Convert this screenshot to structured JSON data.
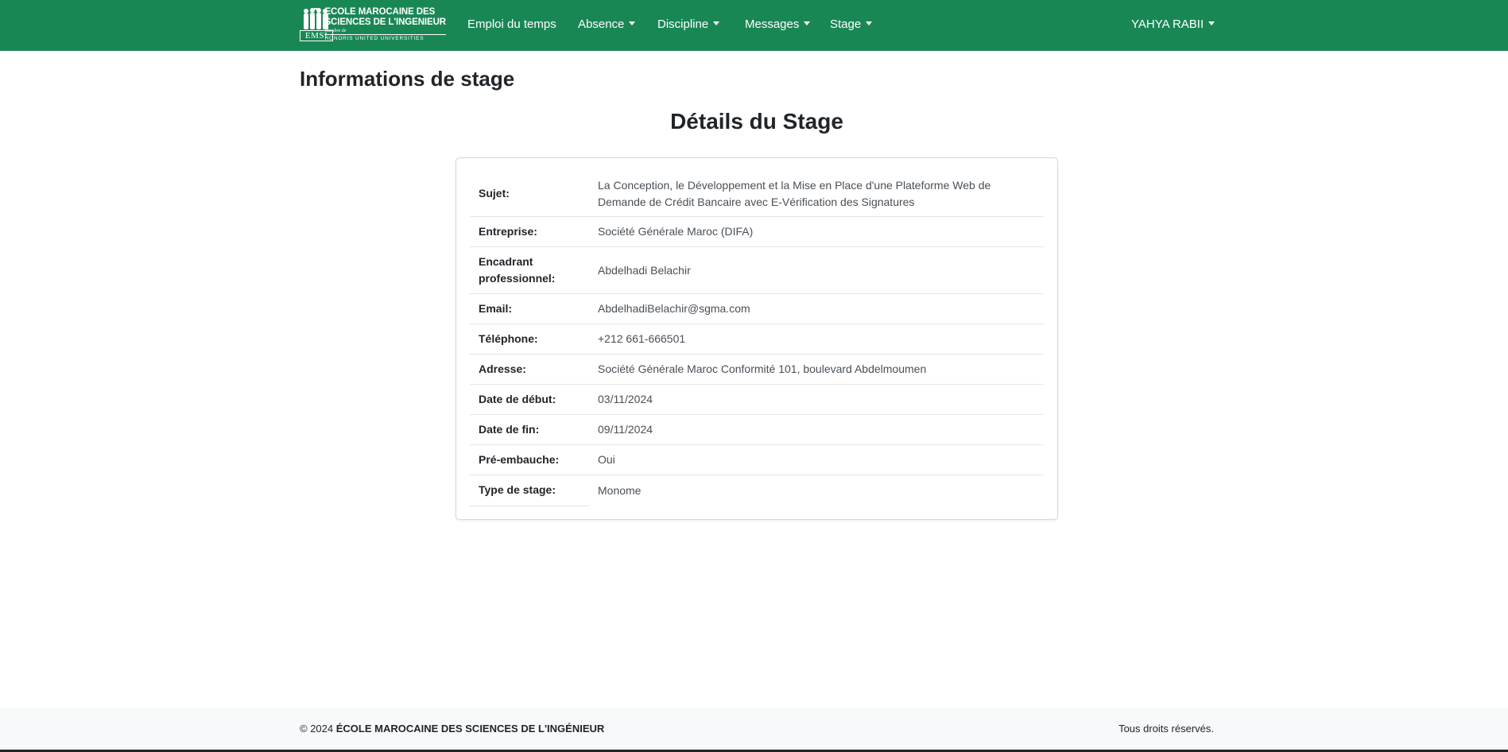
{
  "brand": {
    "line1": "ECOLE MAROCAINE DES",
    "line2": "SCIENCES DE L'INGENIEUR",
    "line3": "Membre de",
    "line4": "HONORIS UNITED UNIVERSITIES",
    "emblem": "EMSI"
  },
  "nav": {
    "items": [
      {
        "label": "Emploi du temps",
        "dropdown": false
      },
      {
        "label": "Absence",
        "dropdown": true
      },
      {
        "label": "Discipline",
        "dropdown": true
      },
      {
        "label": "Messages",
        "dropdown": true
      },
      {
        "label": "Stage",
        "dropdown": true
      }
    ],
    "user": "YAHYA RABII"
  },
  "page": {
    "heading": "Informations de stage",
    "title": "Détails du Stage"
  },
  "details": [
    {
      "label": "Sujet:",
      "value": "La Conception, le Développement et la Mise en Place d'une Plateforme Web de Demande de Crédit Bancaire avec E-Vérification des Signatures"
    },
    {
      "label": "Entreprise:",
      "value": "Société Générale Maroc (DIFA)"
    },
    {
      "label": "Encadrant professionnel:",
      "value": "Abdelhadi Belachir"
    },
    {
      "label": "Email:",
      "value": "AbdelhadiBelachir@sgma.com"
    },
    {
      "label": "Téléphone:",
      "value": "+212 661-666501"
    },
    {
      "label": "Adresse:",
      "value": "Société Générale Maroc Conformité 101, boulevard Abdelmoumen"
    },
    {
      "label": "Date de début:",
      "value": "03/11/2024"
    },
    {
      "label": "Date de fin:",
      "value": "09/11/2024"
    },
    {
      "label": "Pré-embauche:",
      "value": "Oui"
    },
    {
      "label": "Type de stage:",
      "value": "Monome"
    }
  ],
  "footer": {
    "year": "© 2024",
    "school": "ÉCOLE MAROCAINE DES SCIENCES DE L'INGÉNIEUR",
    "rights": "Tous droits réservés."
  },
  "colors": {
    "navbar": "#198754",
    "footer": "#f8f9fa"
  }
}
